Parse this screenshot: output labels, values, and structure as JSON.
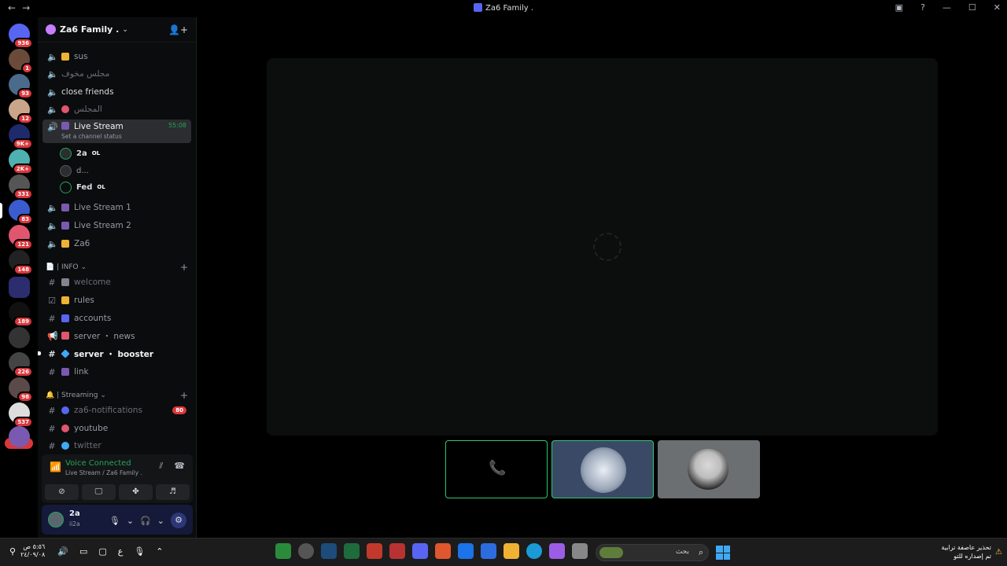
{
  "window": {
    "title": "Za6 Family ."
  },
  "rail": {
    "servers": [
      {
        "name": "direct-messages",
        "badge": "936",
        "color": "#5865f2"
      },
      {
        "name": "server-1",
        "badge": "1",
        "color": "#6a4b3a"
      },
      {
        "name": "server-2",
        "badge": "93",
        "color": "#4a6b8c"
      },
      {
        "name": "server-3",
        "badge": "12",
        "color": "#c9a68a"
      },
      {
        "name": "server-4",
        "badge": "9K+",
        "color": "#1f2a6b"
      },
      {
        "name": "server-5",
        "badge": "2K+",
        "color": "#4fb0b0"
      },
      {
        "name": "server-6",
        "badge": "331",
        "color": "#555"
      },
      {
        "name": "server-7",
        "badge": "83",
        "color": "#3a5ccf"
      },
      {
        "name": "server-8",
        "badge": "121",
        "color": "#e0566e"
      },
      {
        "name": "server-9",
        "badge": "148",
        "color": "#222"
      },
      {
        "name": "folder",
        "badge": "",
        "color": "#2b2d6e"
      },
      {
        "name": "server-10",
        "badge": "189",
        "color": "#111"
      },
      {
        "name": "server-11",
        "badge": "",
        "color": "#333"
      },
      {
        "name": "server-12",
        "badge": "226",
        "color": "#444"
      },
      {
        "name": "server-13",
        "badge": "98",
        "color": "#5a4a4a"
      },
      {
        "name": "server-14",
        "badge": "537",
        "color": "#ddd"
      },
      {
        "name": "server-15",
        "badge": "",
        "color": "#7a5ab0"
      }
    ],
    "new_label": "NEW"
  },
  "server": {
    "name": "Za6 Family ."
  },
  "channels": {
    "voice_top": [
      {
        "label": "sus",
        "emoji_color": "#f0b232"
      },
      {
        "label": "مجلس مخوف",
        "emoji_color": ""
      },
      {
        "label": "close friends",
        "emoji_color": ""
      },
      {
        "label": "المجلس",
        "emoji_color": "#e0566e"
      }
    ],
    "active": {
      "label": "Live Stream",
      "timer": "55:08",
      "status": "Set a channel status"
    },
    "voice_users": [
      {
        "name": "2a",
        "tag": "OL"
      },
      {
        "name": "d...",
        "tag": ""
      },
      {
        "name": "Fed",
        "tag": "OL"
      }
    ],
    "voice_more": [
      {
        "label": "Live Stream 1"
      },
      {
        "label": "Live Stream 2"
      },
      {
        "label": "Za6"
      }
    ],
    "info_category": "| INFO",
    "info": [
      {
        "label": "welcome",
        "emoji_color": "#80848e"
      },
      {
        "label": "rules",
        "emoji_color": "#f0b232"
      },
      {
        "label": "accounts",
        "emoji_color": "#5865f2"
      },
      {
        "label": "server ・ news",
        "emoji_color": "#e0566e"
      },
      {
        "label": "server ・ booster",
        "emoji_color": "#3fa9f5"
      },
      {
        "label": "link",
        "emoji_color": "#7a5ab0"
      }
    ],
    "stream_category": "| Streaming",
    "streaming": [
      {
        "label": "za6-notifications",
        "mention": "80",
        "emoji_color": "#5865f2"
      },
      {
        "label": "youtube",
        "mention": "",
        "emoji_color": "#e0566e"
      },
      {
        "label": "twitter",
        "mention": "",
        "emoji_color": "#3fa9f5"
      }
    ]
  },
  "voice_panel": {
    "status": "Voice Connected",
    "location": "Live Stream / Za6 Family ."
  },
  "user_panel": {
    "name": "2a",
    "status": "ii2a"
  },
  "taskbar": {
    "time": "٥:٥٦ ص",
    "date": "٢٤/٠٩/٠٨",
    "lang": "ع",
    "search_placeholder": "بحث",
    "news_line1": "تحذير عاصفة ترابية",
    "news_line2": "تم إصداره للتو"
  }
}
